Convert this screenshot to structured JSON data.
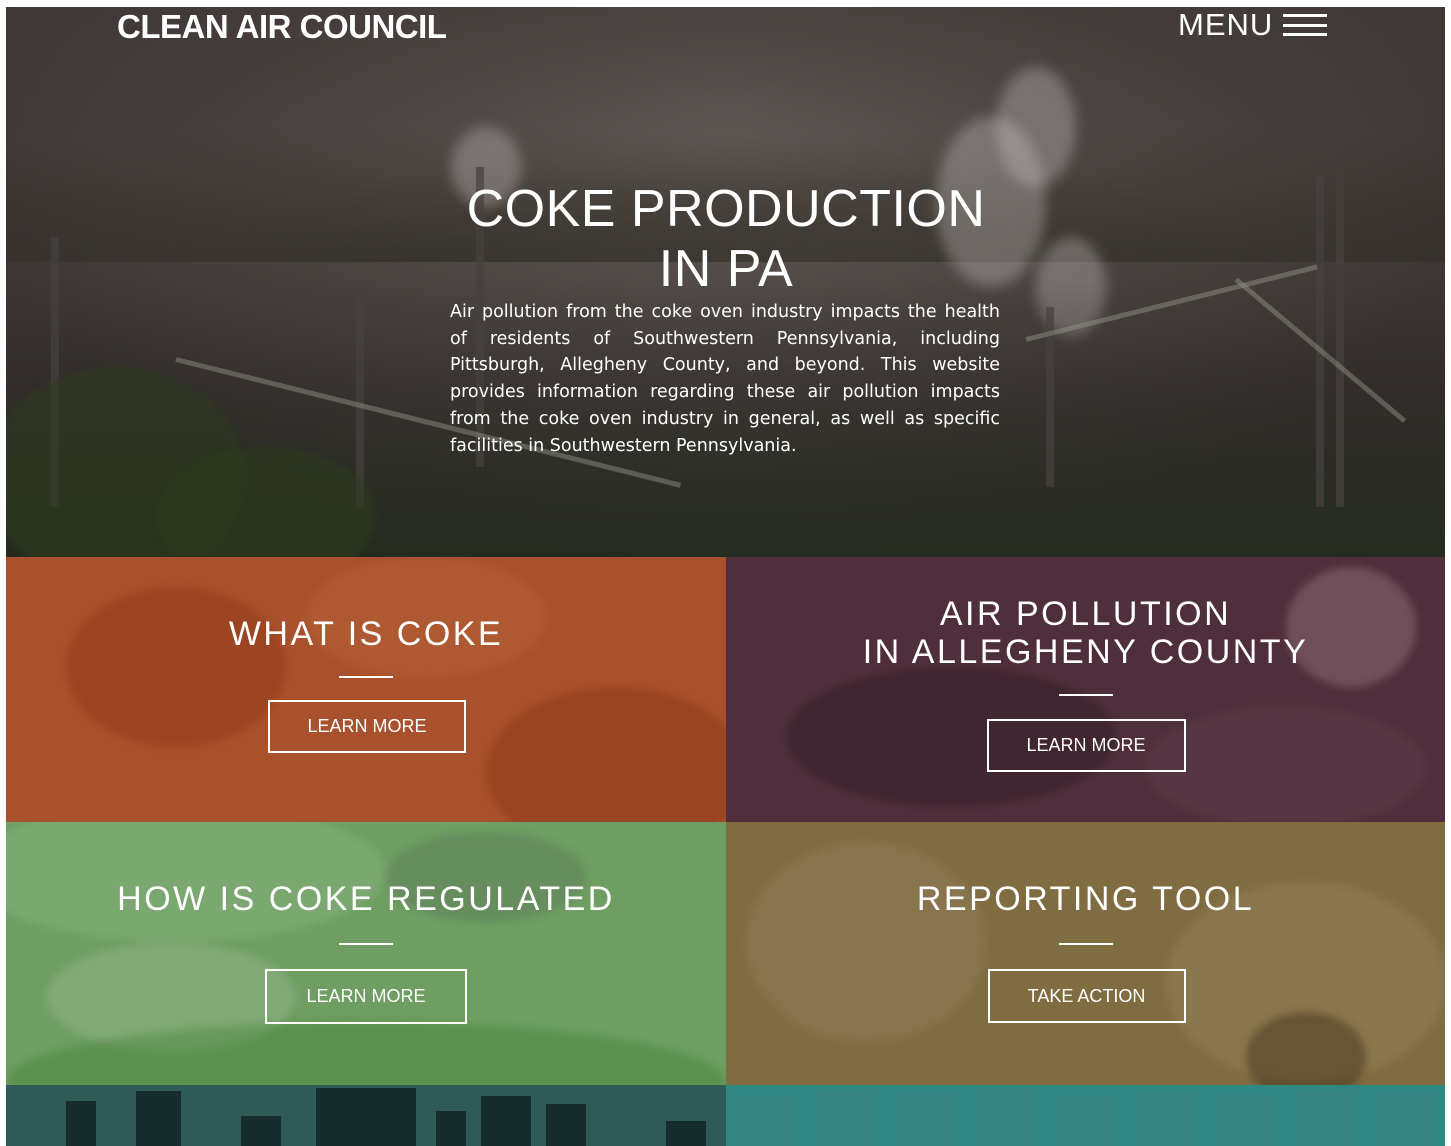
{
  "header": {
    "logo_text": "CLEAN AIR COUNCIL",
    "menu_label": "MENU"
  },
  "hero": {
    "title_line1": "COKE PRODUCTION",
    "title_line2": "IN PA",
    "description": "Air pollution from the coke oven industry impacts the health of residents of Southwestern Pennsylvania, including Pittsburgh, Allegheny County, and beyond. This website provides information regarding these air pollution impacts from the coke oven industry in general, as well as specific facilities in Southwestern Pennsylvania."
  },
  "tiles": [
    {
      "title": "WHAT IS COKE",
      "button": "LEARN MORE",
      "color": "#a9512c"
    },
    {
      "title_line1": "AIR POLLUTION",
      "title_line2": "IN ALLEGHENY COUNTY",
      "button": "LEARN MORE",
      "color": "#4f2f3b"
    },
    {
      "title": "HOW IS COKE REGULATED",
      "button": "LEARN MORE",
      "color": "#6e9e62"
    },
    {
      "title": "REPORTING TOOL",
      "button": "TAKE ACTION",
      "color": "#7f6c41"
    }
  ],
  "partial_tiles": [
    {
      "color": "#2f5b57"
    },
    {
      "color": "#2f8883"
    }
  ]
}
